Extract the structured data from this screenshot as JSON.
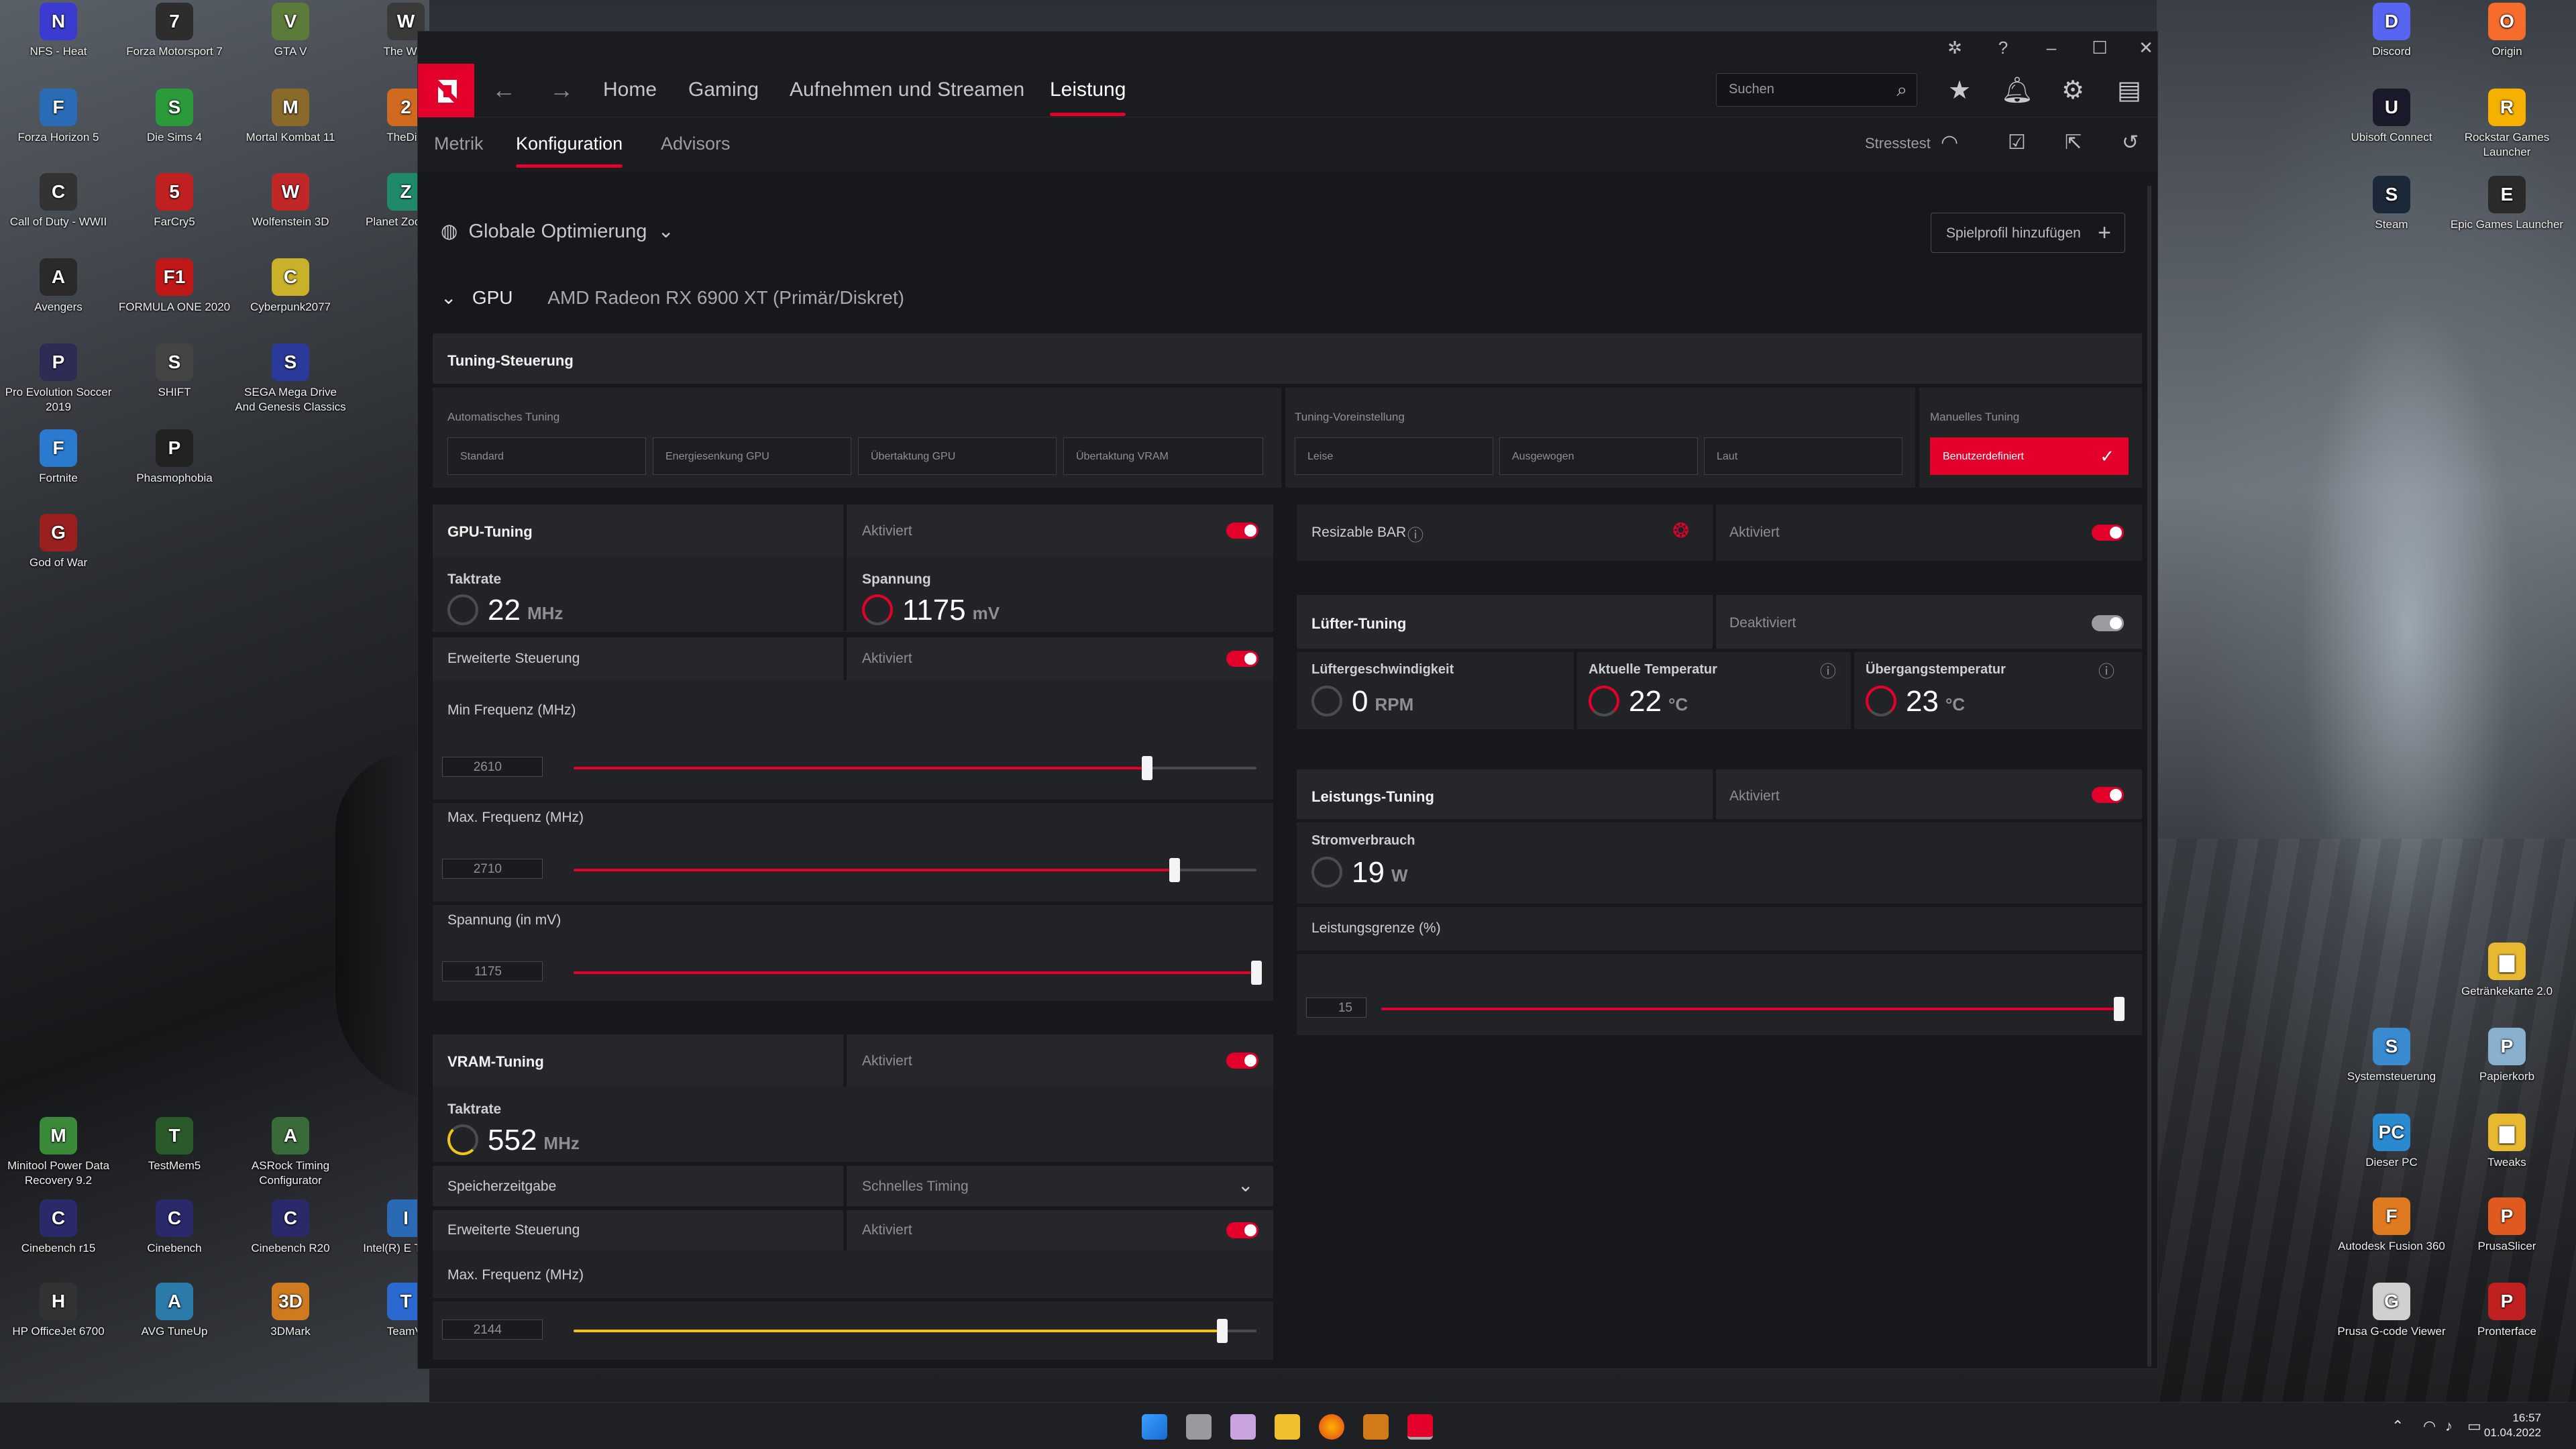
{
  "desktop": {
    "left_icons": [
      {
        "label": "NFS - Heat",
        "color": "#3b3bd0",
        "glyph": "N"
      },
      {
        "label": "Forza Motorsport 7",
        "color": "#2d2d2d",
        "glyph": "7"
      },
      {
        "label": "GTA V",
        "color": "#5c7a3a",
        "glyph": "V"
      },
      {
        "label": "The Witc",
        "color": "#3a3a3a",
        "glyph": "W"
      },
      {
        "label": "Forza Horizon 5",
        "color": "#2a6bb5",
        "glyph": "F"
      },
      {
        "label": "Die Sims 4",
        "color": "#2a9a3a",
        "glyph": "S"
      },
      {
        "label": "Mortal Kombat 11",
        "color": "#8a6a2a",
        "glyph": "M"
      },
      {
        "label": "TheDivi",
        "color": "#d06a20",
        "glyph": "2"
      },
      {
        "label": "Call of Duty - WWII",
        "color": "#333333",
        "glyph": "C"
      },
      {
        "label": "FarCry5",
        "color": "#c02020",
        "glyph": "5"
      },
      {
        "label": "Wolfenstein 3D",
        "color": "#c02828",
        "glyph": "W"
      },
      {
        "label": "Planet Zoo Editi",
        "color": "#1f8a6a",
        "glyph": "Z"
      },
      {
        "label": "Avengers",
        "color": "#2a2a2a",
        "glyph": "A"
      },
      {
        "label": "FORMULA ONE 2020",
        "color": "#c01818",
        "glyph": "F1"
      },
      {
        "label": "Cyberpunk2077",
        "color": "#c9b22a",
        "glyph": "C"
      },
      {
        "label": "Pro Evolution Soccer 2019",
        "color": "#2c2c55",
        "glyph": "P"
      },
      {
        "label": "SHIFT",
        "color": "#444444",
        "glyph": "S"
      },
      {
        "label": "SEGA Mega Drive And Genesis Classics",
        "color": "#2a3a9a",
        "glyph": "S"
      },
      {
        "label": "Fortnite",
        "color": "#2a7ad0",
        "glyph": "F"
      },
      {
        "label": "Phasmophobia",
        "color": "#222222",
        "glyph": "P"
      },
      {
        "label": "God of War",
        "color": "#9a2020",
        "glyph": "G"
      },
      {
        "label": "Minitool Power Data Recovery 9.2",
        "color": "#3a8a3a",
        "glyph": "M"
      },
      {
        "label": "TestMem5",
        "color": "#2a5a2a",
        "glyph": "T"
      },
      {
        "label": "ASRock Timing Configurator",
        "color": "#3a6a3a",
        "glyph": "A"
      },
      {
        "label": "Cinebench r15",
        "color": "#2a2a6a",
        "glyph": "C"
      },
      {
        "label": "Cinebench",
        "color": "#2a2a6a",
        "glyph": "C"
      },
      {
        "label": "Cinebench R20",
        "color": "#2a2a6a",
        "glyph": "C"
      },
      {
        "label": "Intel(R) E Tuning",
        "color": "#2a6ab5",
        "glyph": "I"
      },
      {
        "label": "HP OfficeJet 6700",
        "color": "#333333",
        "glyph": "H"
      },
      {
        "label": "AVG TuneUp",
        "color": "#2a7aaa",
        "glyph": "A"
      },
      {
        "label": "3DMark",
        "color": "#d07a20",
        "glyph": "3D"
      },
      {
        "label": "TeamVi",
        "color": "#2a6ad0",
        "glyph": "T"
      }
    ],
    "right_icons": [
      {
        "label": "Discord",
        "color": "#5865f2",
        "glyph": "D"
      },
      {
        "label": "Origin",
        "color": "#f56c2d",
        "glyph": "O"
      },
      {
        "label": "Ubisoft Connect",
        "color": "#1a1a2a",
        "glyph": "U"
      },
      {
        "label": "Rockstar Games Launcher",
        "color": "#f5b000",
        "glyph": "R"
      },
      {
        "label": "Steam",
        "color": "#1b2838",
        "glyph": "S"
      },
      {
        "label": "Epic Games Launcher",
        "color": "#2a2a2a",
        "glyph": "E"
      },
      {
        "label": "Getränkekarte 2.0",
        "color": "#e8b830",
        "glyph": "▆"
      },
      {
        "label": "Systemsteuerung",
        "color": "#3a8ad0",
        "glyph": "S"
      },
      {
        "label": "Papierkorb",
        "color": "#8ab0d0",
        "glyph": "P"
      },
      {
        "label": "Dieser PC",
        "color": "#2a8ad0",
        "glyph": "PC"
      },
      {
        "label": "Tweaks",
        "color": "#e8b830",
        "glyph": "▆"
      },
      {
        "label": "Autodesk Fusion 360",
        "color": "#e07a20",
        "glyph": "F"
      },
      {
        "label": "PrusaSlicer",
        "color": "#e05a20",
        "glyph": "P"
      },
      {
        "label": "Prusa G-code Viewer",
        "color": "#d0d0d0",
        "glyph": "G"
      },
      {
        "label": "Pronterface",
        "color": "#c02020",
        "glyph": "P"
      }
    ]
  },
  "taskbar": {
    "time": "16:57",
    "date": "01.04.2022",
    "tray_icons": [
      "chevron-up-icon",
      "wifi-icon",
      "speaker-icon",
      "battery-icon"
    ]
  },
  "app": {
    "nav": {
      "tabs": [
        "Home",
        "Gaming",
        "Aufnehmen und Streamen",
        "Leistung"
      ],
      "active": "Leistung",
      "search_placeholder": "Suchen"
    },
    "subnav": {
      "tabs": [
        "Metrik",
        "Konfiguration",
        "Advisors"
      ],
      "active": "Konfiguration",
      "stresstest": "Stresstest"
    },
    "profile": {
      "label": "Globale Optimierung",
      "add_button": "Spielprofil hinzufügen"
    },
    "gpu": {
      "label": "GPU",
      "model": "AMD Radeon RX 6900 XT (Primär/Diskret)"
    },
    "tuning_control": {
      "title": "Tuning-Steuerung",
      "auto_label": "Automatisches Tuning",
      "auto_options": [
        "Standard",
        "Energiesenkung GPU",
        "Übertaktung GPU",
        "Übertaktung VRAM"
      ],
      "preset_label": "Tuning-Voreinstellung",
      "preset_options": [
        "Leise",
        "Ausgewogen",
        "Laut"
      ],
      "manual_label": "Manuelles Tuning",
      "manual_option": "Benutzerdefiniert"
    },
    "gpu_tuning": {
      "title": "GPU-Tuning",
      "status": "Aktiviert",
      "clock_label": "Taktrate",
      "clock_value": "22",
      "clock_unit": "MHz",
      "voltage_label": "Spannung",
      "voltage_value": "1175",
      "voltage_unit": "mV",
      "advanced_label": "Erweiterte Steuerung",
      "advanced_status": "Aktiviert",
      "min_freq_label": "Min Frequenz (MHz)",
      "min_freq_value": "2610",
      "min_freq_fraction": 0.84,
      "max_freq_label": "Max. Frequenz (MHz)",
      "max_freq_value": "2710",
      "max_freq_fraction": 0.88,
      "voltage_slider_label": "Spannung (in mV)",
      "voltage_slider_value": "1175",
      "voltage_slider_fraction": 1.0
    },
    "vram_tuning": {
      "title": "VRAM-Tuning",
      "status": "Aktiviert",
      "clock_label": "Taktrate",
      "clock_value": "552",
      "clock_unit": "MHz",
      "timing_label": "Speicherzeitgabe",
      "timing_value": "Schnelles Timing",
      "advanced_label": "Erweiterte Steuerung",
      "advanced_status": "Aktiviert",
      "max_freq_label": "Max. Frequenz (MHz)",
      "max_freq_value": "2144",
      "max_freq_fraction": 0.95
    },
    "resizable_bar": {
      "title": "Resizable BAR",
      "status": "Aktiviert"
    },
    "fan_tuning": {
      "title": "Lüfter-Tuning",
      "status": "Deaktiviert",
      "speed_label": "Lüftergeschwindigkeit",
      "speed_value": "0",
      "speed_unit": "RPM",
      "temp_label": "Aktuelle Temperatur",
      "temp_value": "22",
      "temp_unit": "°C",
      "junction_label": "Übergangstemperatur",
      "junction_value": "23",
      "junction_unit": "°C"
    },
    "power_tuning": {
      "title": "Leistungs-Tuning",
      "status": "Aktiviert",
      "power_label": "Stromverbrauch",
      "power_value": "19",
      "power_unit": "W",
      "limit_label": "Leistungsgrenze (%)",
      "limit_value": "15",
      "limit_fraction": 1.0
    },
    "colors": {
      "accent": "#e3002b",
      "vram_accent": "#f0c419",
      "panel": "#222327",
      "background": "#17181b"
    }
  }
}
